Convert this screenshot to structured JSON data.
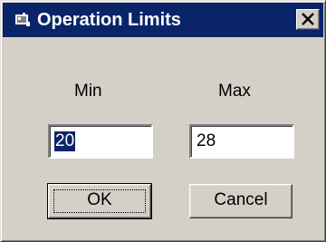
{
  "window": {
    "title": "Operation Limits",
    "title_bar_color": "#0a246a",
    "icon": "app-icon",
    "close_icon": "close-icon"
  },
  "form": {
    "min_label": "Min",
    "max_label": "Max",
    "min_value": "20",
    "max_value": "28"
  },
  "buttons": {
    "ok_label": "OK",
    "cancel_label": "Cancel"
  }
}
